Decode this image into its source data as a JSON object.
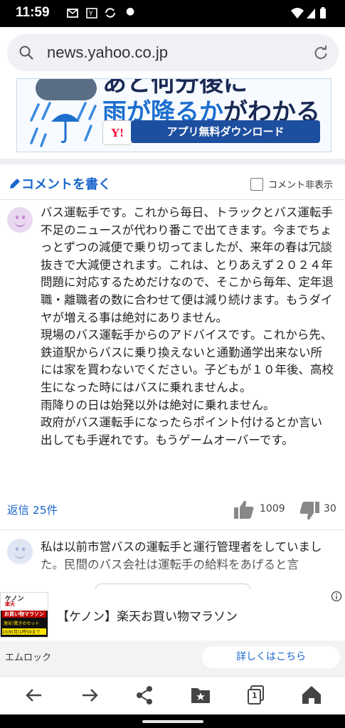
{
  "status_bar": {
    "time": "11:59"
  },
  "browser": {
    "url": "news.yahoo.co.jp"
  },
  "banner": {
    "headline_top": "あと何分後に",
    "headline_blue": "雨が降るか",
    "headline_dark": "がわかる",
    "logo_text": "Y!",
    "download_button": "アプリ無料ダウンロード"
  },
  "comments_header": {
    "write_comment": "コメントを書く",
    "hide_comments_label": "コメント非表示"
  },
  "comments": [
    {
      "text": "バス運転手です。これから毎日、トラックとバス運転手不足のニュースが代わり番こで出てきます。今までちょっとずつの減便で乗り切ってましたが、来年の春は冗談抜きで大減便されます。これは、とりあえず２０２４年問題に対応するためだけなので、そこから毎年、定年退職・離職者の数に合わせて便は減り続けます。もうダイヤが増える事は絶対にありません。\n現場のバス運転手からのアドバイスです。これから先、鉄道駅からバスに乗り換えないと通勤通学出来ない所には家を買わないでください。子どもが１０年後、高校生になった時にはバスに乗れませんよ。\n雨降りの日は始発以外は絶対に乗れません。\n政府がバス運転手になったらポイント付けるとか言い出しても手遅れです。もうゲームオーバーです。",
      "reply_label": "返信 25件",
      "likes": "1009",
      "dislikes": "30"
    },
    {
      "text": "私は以前市営バスの運転手と運行管理者をしていました。民間のバス会社は運転手の給料をあげると言"
    }
  ],
  "ad": {
    "thumb_lines": [
      "ケノン",
      "楽天",
      "お買い物マラソン",
      "激安!驚きのセット",
      "10/9(月)1時59まで"
    ],
    "title": "【ケノン】楽天お買い物マラソン",
    "advertiser": "エムロック",
    "cta": "詳しくはこちら"
  },
  "toolbar": {
    "tab_count": "1"
  },
  "colors": {
    "link_blue": "#1a66cc",
    "banner_blue": "#1d4fa0",
    "yahoo_red": "#ff0033"
  }
}
